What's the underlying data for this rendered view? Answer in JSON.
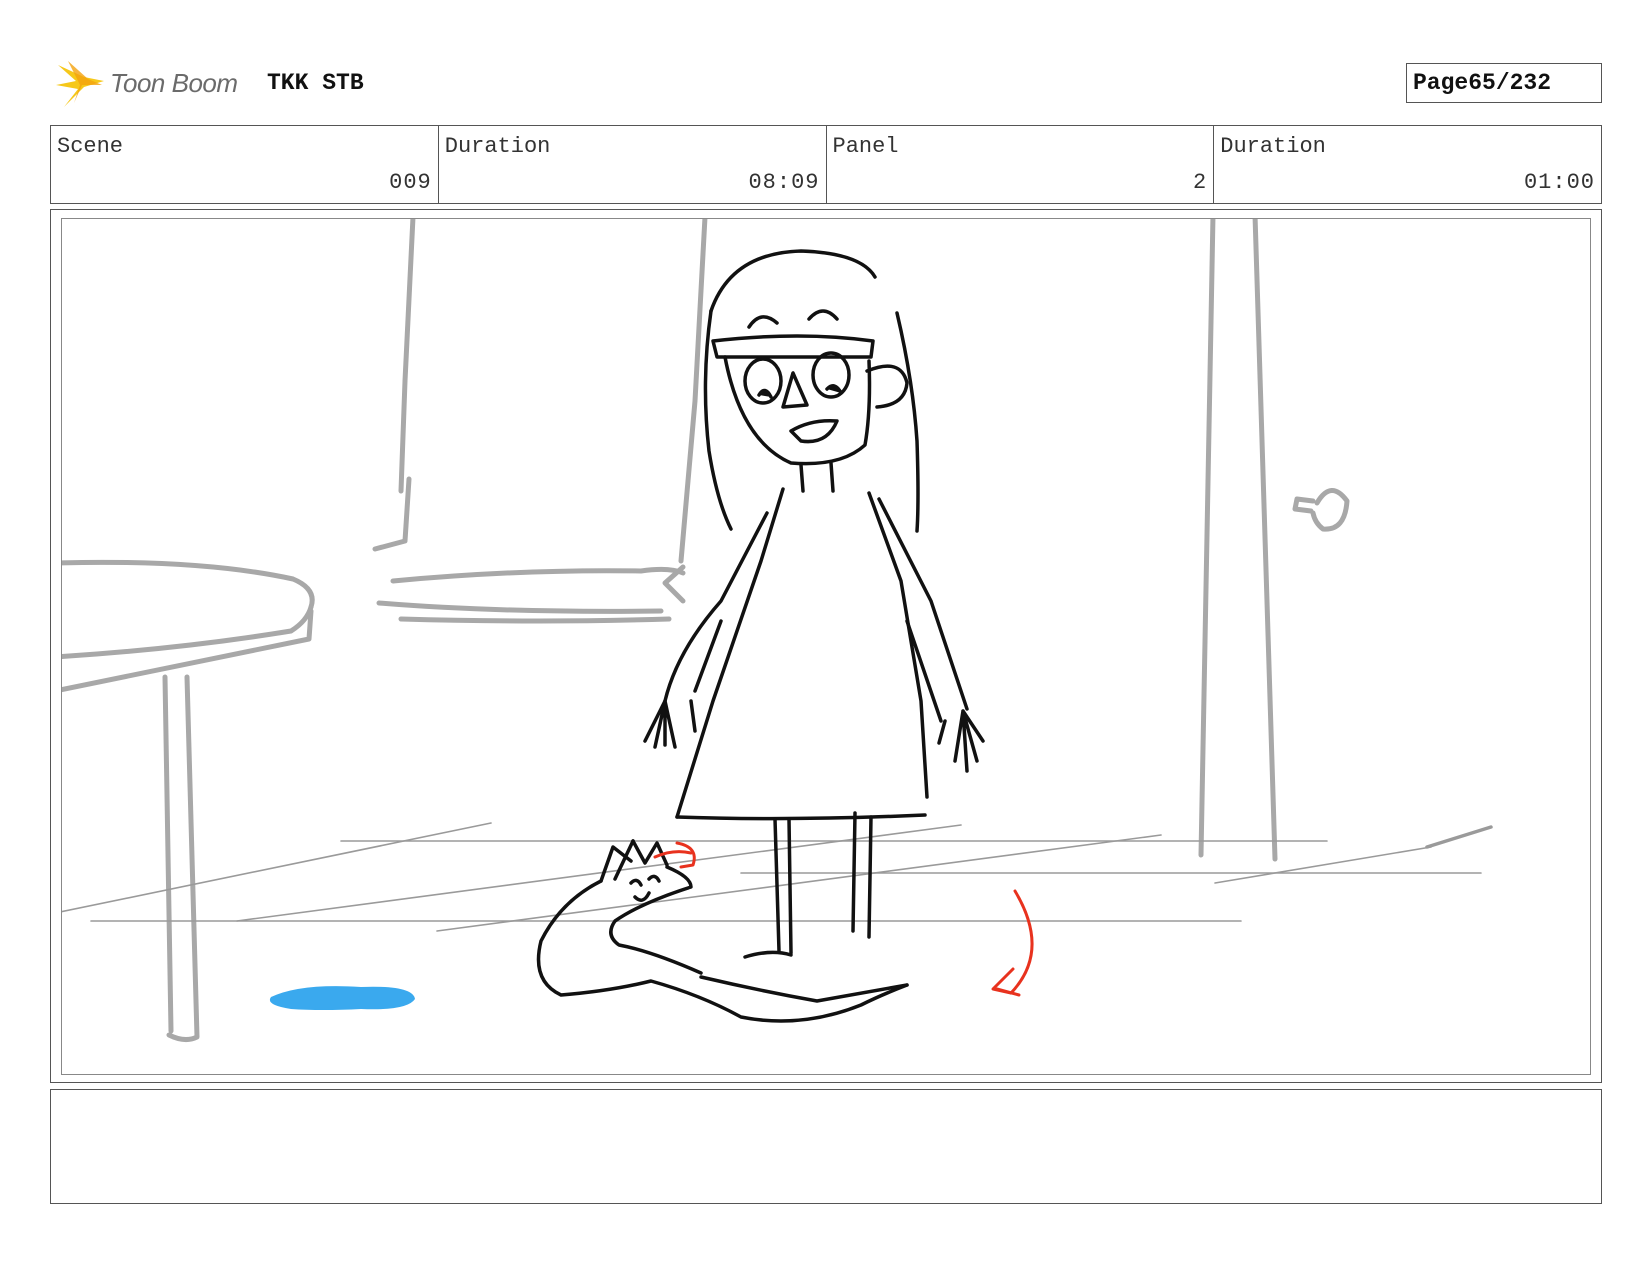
{
  "header": {
    "logo_text": "Toon Boom",
    "project_title": "TKK STB",
    "page_label": "Page",
    "page_value": "65/232"
  },
  "info": {
    "scene_label": "Scene",
    "scene_value": "009",
    "scene_duration_label": "Duration",
    "scene_duration_value": "08:09",
    "panel_label": "Panel",
    "panel_value": "2",
    "panel_duration_label": "Duration",
    "panel_duration_value": "01:00"
  },
  "notes": {
    "text": ""
  },
  "colors": {
    "sketch_black": "#111111",
    "background_grey": "#a8a8a8",
    "floor_grey": "#9a9a9a",
    "puddle_blue": "#3aa9ee",
    "arrow_red": "#e8321e",
    "logo_yellow": "#f6c81a"
  }
}
